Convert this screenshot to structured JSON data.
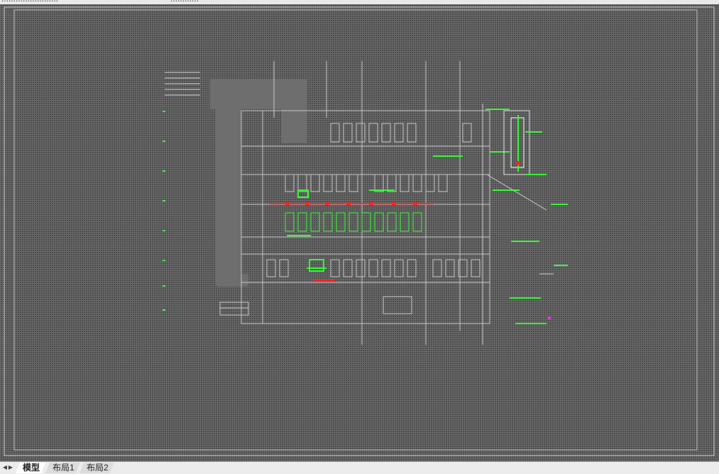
{
  "window": {
    "title_left": "……………………",
    "title_right": "…………"
  },
  "colors": {
    "canvas_bg": "#4a4a4a",
    "grid": "#6c6c6c",
    "lines": "#c8c8c8",
    "green": "#33ff33",
    "red": "#ff2222",
    "magenta": "#ff33ff"
  },
  "tabs": [
    {
      "label": "模型",
      "active": true
    },
    {
      "label": "布局1",
      "active": false
    },
    {
      "label": "布局2",
      "active": false
    }
  ]
}
